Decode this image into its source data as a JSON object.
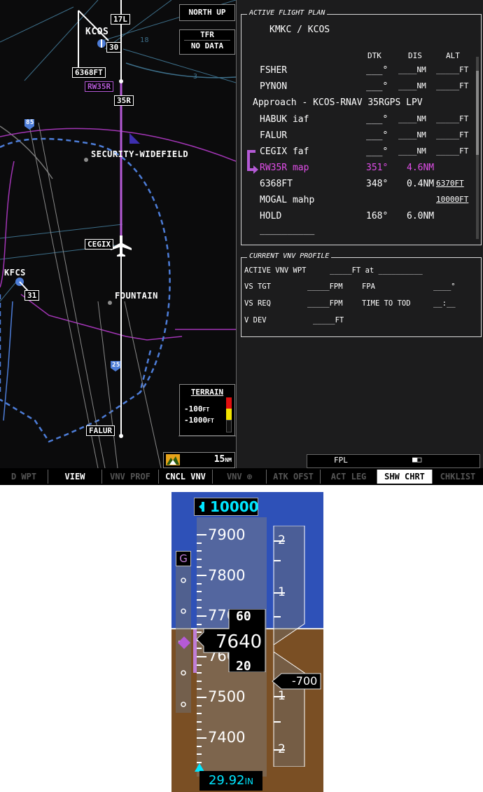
{
  "map": {
    "orientation": "NORTH UP",
    "tfr": {
      "label": "TFR",
      "value": "NO DATA"
    },
    "labels": {
      "kcos": "KCOS",
      "rwy_17l": "17L",
      "rwy_30": "30",
      "rwy_35l": "35",
      "fix_6368": "6368FT",
      "rw35r": "RW35R",
      "rwy_35r": "35R",
      "security": "SECURITY-WIDEFIELD",
      "cegix": "CEGIX",
      "kfcs": "KFCS",
      "rwy_31": "31",
      "fountain": "FOUNTAIN",
      "falur": "FALUR",
      "hwy_85": "85",
      "hwy_25": "25",
      "num_18": "18",
      "num_3": "3",
      "range_value": "15",
      "range_unit": "NM"
    },
    "terrain": {
      "title": "TERRAIN",
      "upper": "-100",
      "lower": "-1000",
      "unit": "FT"
    }
  },
  "flight_plan": {
    "title": "ACTIVE FLIGHT PLAN",
    "route": "KMKC / KCOS",
    "columns": {
      "dtk": "DTK",
      "dis": "DIS",
      "alt": "ALT"
    },
    "rows": [
      {
        "name": "FSHER",
        "dtk": "___°",
        "dis": "____NM",
        "alt": "_____FT"
      },
      {
        "name": "PYNON",
        "dtk": "___°",
        "dis": "____NM",
        "alt": "_____FT"
      },
      {
        "name": "Approach - KCOS-RNAV 35RGPS LPV",
        "dtk": "",
        "dis": "",
        "alt": ""
      },
      {
        "name": "HABUK iaf",
        "dtk": "___°",
        "dis": "____NM",
        "alt": "_____FT"
      },
      {
        "name": "FALUR",
        "dtk": "___°",
        "dis": "____NM",
        "alt": "_____FT"
      },
      {
        "name": "CEGIX faf",
        "dtk": "___°",
        "dis": "____NM",
        "alt": "_____FT"
      },
      {
        "name": "RW35R map",
        "dtk": "351°",
        "dis": "4.6NM",
        "alt": ""
      },
      {
        "name": "6368FT",
        "dtk": "348°",
        "dis": "0.4NM",
        "alt": "6370FT"
      },
      {
        "name": "MOGAL mahp",
        "dtk": "",
        "dis": "",
        "alt": "10000FT"
      },
      {
        "name": "HOLD",
        "dtk": "168°",
        "dis": "6.0NM",
        "alt": ""
      },
      {
        "name": "__________",
        "dtk": "",
        "dis": "",
        "alt": ""
      }
    ]
  },
  "vnv": {
    "title": "CURRENT VNV PROFILE",
    "active_wpt_label": "ACTIVE VNV WPT",
    "active_wpt_value": "_____FT  at  __________",
    "vs_tgt_label": "VS TGT",
    "vs_tgt_value": "_____FPM",
    "fpa_label": "FPA",
    "fpa_value": "____°",
    "vs_req_label": "VS REQ",
    "vs_req_value": "_____FPM",
    "time_tod_label": "TIME TO TOD",
    "time_tod_value": "__:__",
    "vdev_label": "V DEV",
    "vdev_value": "_____FT"
  },
  "status": {
    "page": "FPL",
    "page_indicator": "■□"
  },
  "softkeys": [
    "D WPT",
    "VIEW",
    "VNV PROF",
    "CNCL VNV",
    "VNV ⊕",
    "ATK OFST",
    "ACT LEG",
    "SHW CHRT",
    "CHKLIST"
  ],
  "altimeter": {
    "selected_altitude": "10000",
    "tape_labels": [
      "7900",
      "7800",
      "7700",
      "7600",
      "7500",
      "7400"
    ],
    "current_altitude": "7640",
    "roll_upper": "60",
    "roll_lower": "20",
    "vdi_label": "G",
    "vs_labels": [
      "2",
      "1",
      "1",
      "2"
    ],
    "vs_value": "-700",
    "barometric_setting": "29.92",
    "baro_unit": "IN",
    "colors": {
      "sky": "#2e51b8",
      "ground": "#7a4f24",
      "cyan": "#00e6ff",
      "magenta": "#b55ad6"
    }
  }
}
